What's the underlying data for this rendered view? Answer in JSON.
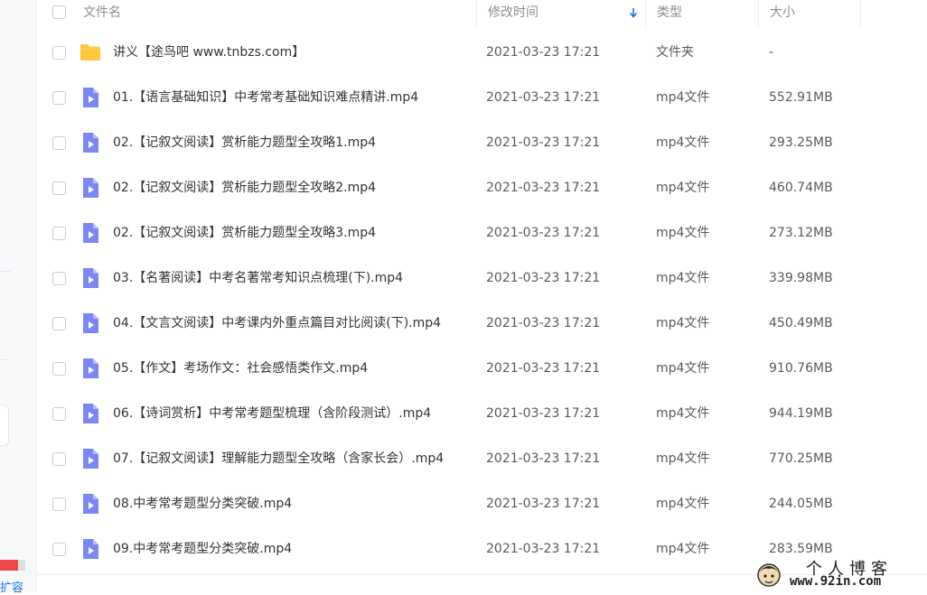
{
  "header": {
    "name": "文件名",
    "modified": "修改时间",
    "type": "类型",
    "size": "大小"
  },
  "files": [
    {
      "name": "讲义【途鸟吧 www.tnbzs.com】",
      "date": "2021-03-23 17:21",
      "type": "文件夹",
      "size": "-",
      "icon": "folder-icon"
    },
    {
      "name": "01.【语言基础知识】中考常考基础知识难点精讲.mp4",
      "date": "2021-03-23 17:21",
      "type": "mp4文件",
      "size": "552.91MB",
      "icon": "video-file-icon"
    },
    {
      "name": "02.【记叙文阅读】赏析能力题型全攻略1.mp4",
      "date": "2021-03-23 17:21",
      "type": "mp4文件",
      "size": "293.25MB",
      "icon": "video-file-icon"
    },
    {
      "name": "02.【记叙文阅读】赏析能力题型全攻略2.mp4",
      "date": "2021-03-23 17:21",
      "type": "mp4文件",
      "size": "460.74MB",
      "icon": "video-file-icon"
    },
    {
      "name": "02.【记叙文阅读】赏析能力题型全攻略3.mp4",
      "date": "2021-03-23 17:21",
      "type": "mp4文件",
      "size": "273.12MB",
      "icon": "video-file-icon"
    },
    {
      "name": "03.【名著阅读】中考名著常考知识点梳理(下).mp4",
      "date": "2021-03-23 17:21",
      "type": "mp4文件",
      "size": "339.98MB",
      "icon": "video-file-icon"
    },
    {
      "name": "04.【文言文阅读】中考课内外重点篇目对比阅读(下).mp4",
      "date": "2021-03-23 17:21",
      "type": "mp4文件",
      "size": "450.49MB",
      "icon": "video-file-icon"
    },
    {
      "name": "05.【作文】考场作文：社会感悟类作文.mp4",
      "date": "2021-03-23 17:21",
      "type": "mp4文件",
      "size": "910.76MB",
      "icon": "video-file-icon"
    },
    {
      "name": "06.【诗词赏析】中考常考题型梳理（含阶段测试）.mp4",
      "date": "2021-03-23 17:21",
      "type": "mp4文件",
      "size": "944.19MB",
      "icon": "video-file-icon"
    },
    {
      "name": "07.【记叙文阅读】理解能力题型全攻略（含家长会）.mp4",
      "date": "2021-03-23 17:21",
      "type": "mp4文件",
      "size": "770.25MB",
      "icon": "video-file-icon"
    },
    {
      "name": "08.中考常考题型分类突破.mp4",
      "date": "2021-03-23 17:21",
      "type": "mp4文件",
      "size": "244.05MB",
      "icon": "video-file-icon"
    },
    {
      "name": "09.中考常考题型分类突破.mp4",
      "date": "2021-03-23 17:21",
      "type": "mp4文件",
      "size": "283.59MB",
      "icon": "video-file-icon"
    }
  ],
  "sidebar": {
    "expand_label": "扩容",
    "storage_used_fraction": 0.72
  },
  "watermark": {
    "title": "个人博客",
    "url": "www.92in.com"
  },
  "colors": {
    "folder": "#ffc83d",
    "video": "#7b87f5",
    "storage_bar": "#f0474a",
    "link": "#1a73e8"
  }
}
